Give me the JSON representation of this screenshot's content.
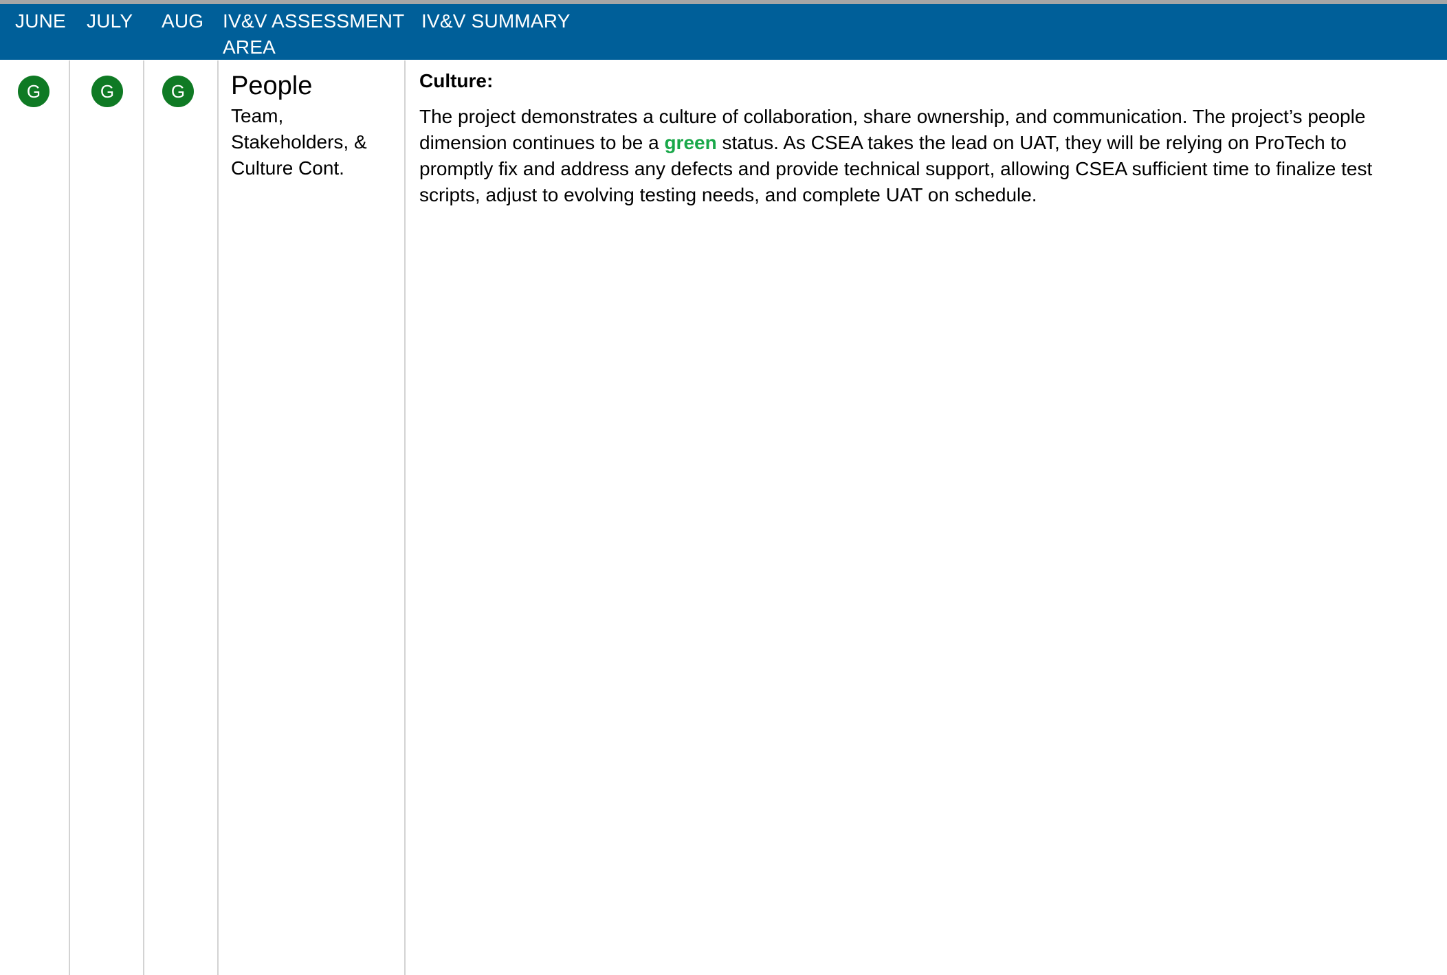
{
  "header": {
    "col_june": "JUNE",
    "col_july": "JULY",
    "col_aug": "AUG",
    "col_area": "IV&V ASSESSMENT AREA",
    "col_summary": "IV&V SUMMARY"
  },
  "row": {
    "status_june": "G",
    "status_july": "G",
    "status_aug": "G",
    "area_title": "People",
    "area_subtitle": "Team, Stakeholders, & Culture Cont.",
    "summary_heading": "Culture:",
    "summary_part1": "The project demonstrates a culture of collaboration, share ownership, and communication.  The project’s people dimension continues to be a ",
    "summary_highlight": "green",
    "summary_part2": " status.  As CSEA takes the lead on UAT, they will be relying on ProTech to promptly fix and address any defects and provide technical support, allowing CSEA sufficient time to finalize test scripts, adjust to evolving testing needs, and complete UAT on schedule."
  },
  "colors": {
    "header_bg": "#005f99",
    "status_green": "#0f7a24",
    "highlight_green": "#1aa84a",
    "grid_line": "#d3d3d3"
  }
}
